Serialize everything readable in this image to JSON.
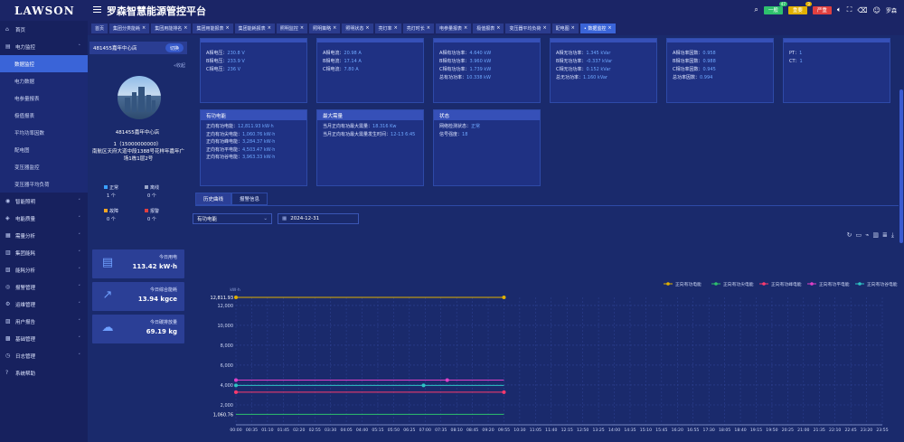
{
  "brand": {
    "logo": "LAWSON",
    "title": "罗森智慧能源管控平台"
  },
  "topbar": {
    "pills": [
      {
        "label": "一般",
        "badge": "47",
        "color": "#2ec16d"
      },
      {
        "label": "重要",
        "badge": "3",
        "color": "#e0b000"
      },
      {
        "label": "严重",
        "badge": "",
        "color": "#e04040"
      }
    ],
    "user": "罗森"
  },
  "sidebar": {
    "items": [
      {
        "label": "首页",
        "icon": "home-icon",
        "glyph": "⌂"
      },
      {
        "label": "电力监控",
        "icon": "power-icon",
        "glyph": "▤",
        "expanded": true,
        "children": [
          {
            "label": "数据监控",
            "active": true
          },
          {
            "label": "电力数据"
          },
          {
            "label": "电参量报表"
          },
          {
            "label": "极值报表"
          },
          {
            "label": "平均功率因数"
          },
          {
            "label": "配电图"
          },
          {
            "label": "变压器监控"
          },
          {
            "label": "变压器平均负荷"
          }
        ]
      },
      {
        "label": "智能照明",
        "icon": "lightbulb-icon",
        "glyph": "◉"
      },
      {
        "label": "电能质量",
        "icon": "quality-icon",
        "glyph": "◈"
      },
      {
        "label": "需量分析",
        "icon": "demand-icon",
        "glyph": "▦"
      },
      {
        "label": "集团能耗",
        "icon": "group-icon",
        "glyph": "▥"
      },
      {
        "label": "能耗分析",
        "icon": "analysis-icon",
        "glyph": "▧"
      },
      {
        "label": "报警管理",
        "icon": "alarm-icon",
        "glyph": "◎"
      },
      {
        "label": "运维管理",
        "icon": "maintenance-icon",
        "glyph": "⚙"
      },
      {
        "label": "用户报告",
        "icon": "report-icon",
        "glyph": "▨"
      },
      {
        "label": "基础管理",
        "icon": "basic-icon",
        "glyph": "▩"
      },
      {
        "label": "日志管理",
        "icon": "log-icon",
        "glyph": "◷"
      },
      {
        "label": "系统帮助",
        "icon": "help-icon",
        "glyph": "?"
      }
    ]
  },
  "tabs": [
    {
      "label": "首页"
    },
    {
      "label": "集团分类能耗"
    },
    {
      "label": "集团用能排名"
    },
    {
      "label": "集团用能报表"
    },
    {
      "label": "集团能耗报表"
    },
    {
      "label": "照明监控"
    },
    {
      "label": "照明策略"
    },
    {
      "label": "照明状态"
    },
    {
      "label": "亮灯率"
    },
    {
      "label": "亮灯时长"
    },
    {
      "label": "电参量报表"
    },
    {
      "label": "极值报表"
    },
    {
      "label": "变压器平均负荷"
    },
    {
      "label": "配电图"
    },
    {
      "label": "• 数据监控",
      "active": true
    }
  ],
  "store": {
    "head": "481455嘉年中心店",
    "switch": "切换",
    "collapse": "«收起",
    "name": "481455嘉年中心店",
    "phone": "1（15000000000）",
    "address": "南航区天府大道中段1388号花样年嘉年广场1栋1层2号",
    "legend": [
      {
        "label": "正常",
        "value": "1 个",
        "color": "#3aa0ff"
      },
      {
        "label": "离线",
        "value": "0 个",
        "color": "#9aa6c8"
      },
      {
        "label": "故障",
        "value": "0 个",
        "color": "#f5a623"
      },
      {
        "label": "报警",
        "value": "0 个",
        "color": "#e04040"
      }
    ],
    "stats": [
      {
        "label": "今日用电",
        "value": "113.42 kW·h",
        "icon": "document-icon",
        "glyph": "▤"
      },
      {
        "label": "今日综合能耗",
        "value": "13.94 kgce",
        "icon": "trend-icon",
        "glyph": "↗"
      },
      {
        "label": "今日碳排放量",
        "value": "69.19 kg",
        "icon": "cloud-co2-icon",
        "glyph": "☁"
      }
    ]
  },
  "cards_top": [
    {
      "rows": [
        {
          "k": "A相电压：",
          "v": "230.8 V"
        },
        {
          "k": "B相电压：",
          "v": "233.9 V"
        },
        {
          "k": "C相电压：",
          "v": "236 V"
        }
      ]
    },
    {
      "rows": [
        {
          "k": "A相电流：",
          "v": "20.98 A"
        },
        {
          "k": "B相电流：",
          "v": "17.14 A"
        },
        {
          "k": "C相电流：",
          "v": "7.80 A"
        }
      ]
    },
    {
      "rows": [
        {
          "k": "A相有功功率：",
          "v": "4.640 kW"
        },
        {
          "k": "B相有功功率：",
          "v": "3.960 kW"
        },
        {
          "k": "C相有功功率：",
          "v": "1.739 kW"
        },
        {
          "k": "总有功功率：",
          "v": "10.338 kW"
        }
      ]
    },
    {
      "rows": [
        {
          "k": "A相无功功率：",
          "v": "1.345 kVar"
        },
        {
          "k": "B相无功功率：",
          "v": "-0.337 kVar"
        },
        {
          "k": "C相无功功率：",
          "v": "0.152 kVar"
        },
        {
          "k": "总无功功率：",
          "v": "1.160 kVar"
        }
      ]
    },
    {
      "rows": [
        {
          "k": "A相功率因数：",
          "v": "0.958"
        },
        {
          "k": "B相功率因数：",
          "v": "0.988"
        },
        {
          "k": "C相功率因数：",
          "v": "0.945"
        },
        {
          "k": "总功率因数：",
          "v": "0.994"
        }
      ]
    },
    {
      "rows": [
        {
          "k": "PT：",
          "v": "1"
        },
        {
          "k": "CT：",
          "v": "1"
        }
      ]
    }
  ],
  "cards_mid": [
    {
      "title": "有功电能",
      "rows": [
        {
          "k": "正向有功电能：",
          "v": "12,811.93 kW·h"
        },
        {
          "k": "正向有功尖电能：",
          "v": "1,060.76 kW·h"
        },
        {
          "k": "正向有功峰电能：",
          "v": "3,284.37 kW·h"
        },
        {
          "k": "正向有功平电能：",
          "v": "4,503.47 kW·h"
        },
        {
          "k": "正向有功谷电能：",
          "v": "3,963.33 kW·h"
        }
      ]
    },
    {
      "title": "最大需量",
      "rows": [
        {
          "k": "当月正向有功最大需量：",
          "v": "18.316 Kw"
        },
        {
          "k": "当月正向有功最大需量发生时间：",
          "v": "12-13 6:45"
        }
      ]
    },
    {
      "title": "状态",
      "rows": [
        {
          "k": "网络检测状态：",
          "v": "正常"
        },
        {
          "k": "信号强度：",
          "v": "18"
        }
      ]
    }
  ],
  "chart_tabs": [
    "历史曲线",
    "报警信息"
  ],
  "chart_controls": {
    "metric": "有功电能",
    "date": "2024-12-31"
  },
  "chart_data": {
    "type": "line",
    "ylabel": "kW·h",
    "ylim": [
      0,
      12811.93
    ],
    "yticks": [
      0,
      2000,
      4000,
      6000,
      8000,
      10000,
      12000
    ],
    "ytick_labels": [
      "2,000",
      "4,000",
      "6,000",
      "8,000",
      "10,000",
      "12,000"
    ],
    "special_ticks": [
      {
        "value": 1060.76,
        "label": "1,060.76"
      },
      {
        "value": 12811.93,
        "label": "12,811.93"
      }
    ],
    "x": [
      "00:00",
      "00:35",
      "01:10",
      "01:45",
      "02:20",
      "02:55",
      "03:30",
      "04:05",
      "04:40",
      "05:15",
      "05:50",
      "06:25",
      "07:00",
      "07:35",
      "08:10",
      "08:45",
      "09:20",
      "09:55",
      "10:30",
      "11:05",
      "11:40",
      "12:15",
      "12:50",
      "13:25",
      "14:00",
      "14:35",
      "15:10",
      "15:45",
      "16:20",
      "16:55",
      "17:30",
      "18:05",
      "18:40",
      "19:15",
      "19:50",
      "20:25",
      "21:00",
      "21:35",
      "22:10",
      "22:45",
      "23:20",
      "23:55"
    ],
    "series": [
      {
        "name": "正向有功电能",
        "color": "#e0b000",
        "points": [
          [
            0,
            12811.93
          ],
          [
            17,
            12811.93
          ]
        ],
        "marks": [
          0,
          17
        ]
      },
      {
        "name": "正向有功尖电能",
        "color": "#2ec16d",
        "points": [
          [
            0,
            1060.76
          ],
          [
            17,
            1060.76
          ]
        ],
        "marks": []
      },
      {
        "name": "正向有功峰电能",
        "color": "#ff3a6e",
        "points": [
          [
            0,
            3284.37
          ],
          [
            17,
            3284.37
          ]
        ],
        "marks": [
          0,
          17
        ]
      },
      {
        "name": "正向有功平电能",
        "color": "#e040c8",
        "points": [
          [
            0,
            4503.47
          ],
          [
            17,
            4503.47
          ]
        ],
        "marks": [
          0,
          13.4
        ]
      },
      {
        "name": "正向有功谷电能",
        "color": "#2ec4c4",
        "points": [
          [
            0,
            3963.33
          ],
          [
            17,
            3963.33
          ]
        ],
        "marks": [
          0,
          11.9
        ]
      }
    ]
  }
}
